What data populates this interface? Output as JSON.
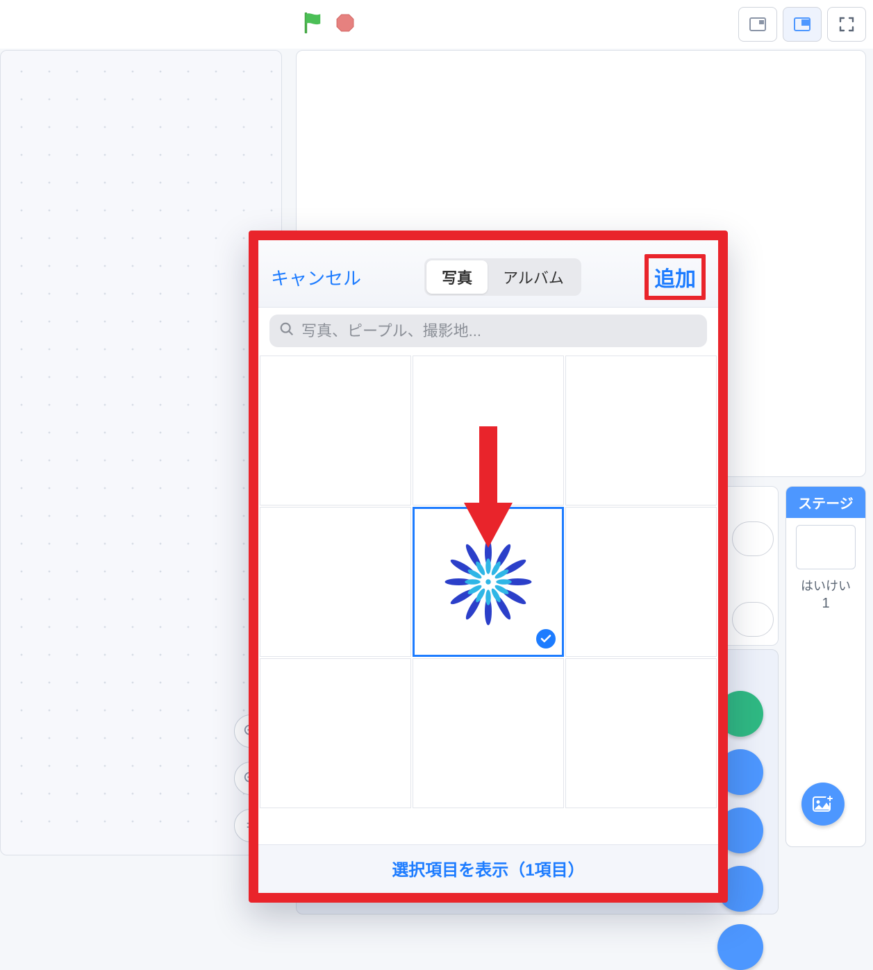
{
  "toolbar": {},
  "stage_panel": {
    "header": "ステージ",
    "backdrop_label": "はいけい",
    "backdrop_count": "1"
  },
  "picker": {
    "cancel": "キャンセル",
    "add": "追加",
    "segments": {
      "photos": "写真",
      "albums": "アルバム"
    },
    "search_placeholder": "写真、ピープル、撮影地...",
    "footer": "選択項目を表示（1項目）",
    "grid": {
      "rows": 3,
      "cols": 3,
      "selected_index": 4
    }
  }
}
